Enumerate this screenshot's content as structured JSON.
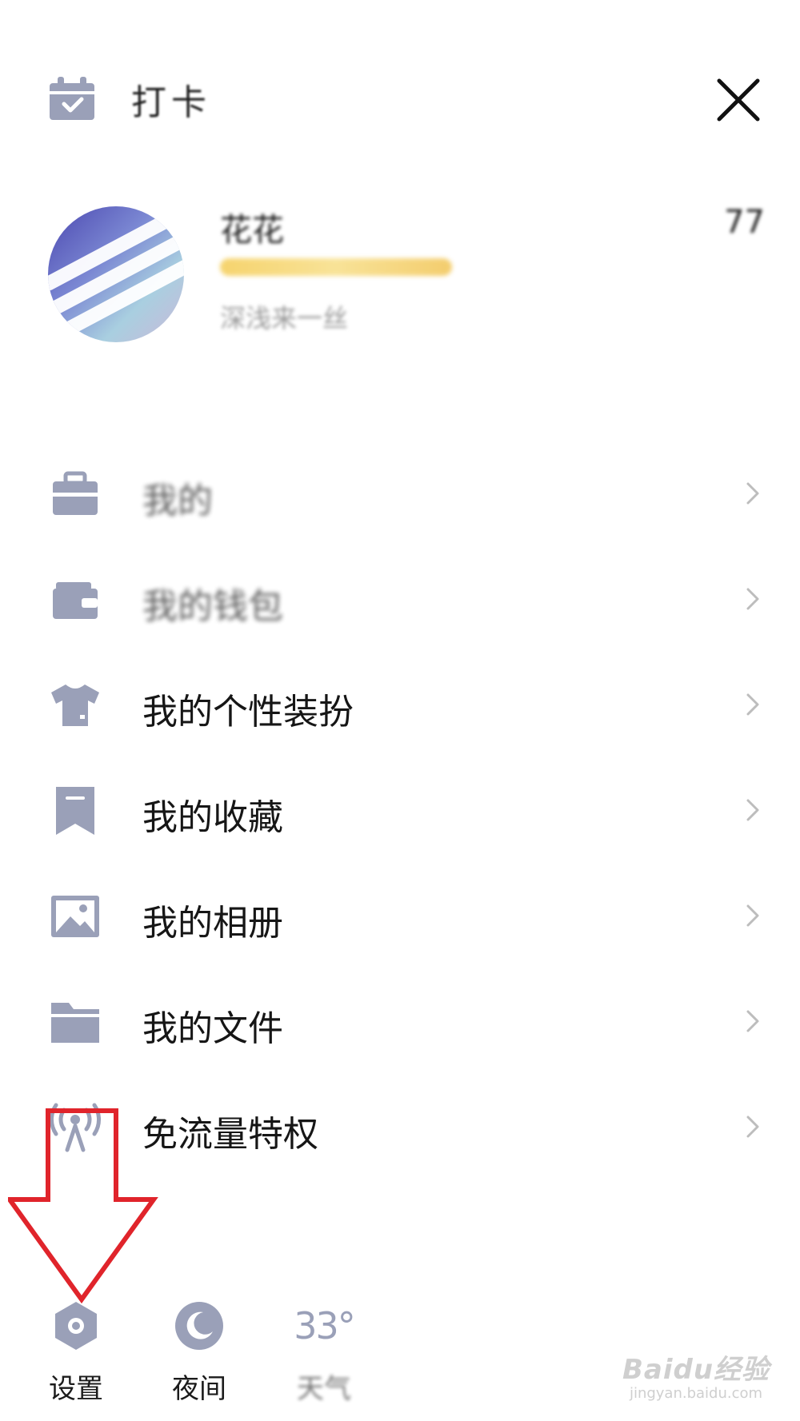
{
  "header": {
    "checkin_label": "打卡",
    "close_icon": "close-icon"
  },
  "profile": {
    "name": "花花",
    "extra": "77",
    "bio": "深浅来一丝"
  },
  "menu": {
    "items": [
      {
        "label": "我的",
        "icon": "bag-icon",
        "blurred": true
      },
      {
        "label": "我的钱包",
        "icon": "wallet-icon",
        "blurred": true
      },
      {
        "label": "我的个性装扮",
        "icon": "shirt-icon",
        "blurred": false
      },
      {
        "label": "我的收藏",
        "icon": "bookmark-icon",
        "blurred": false
      },
      {
        "label": "我的相册",
        "icon": "image-icon",
        "blurred": false
      },
      {
        "label": "我的文件",
        "icon": "folder-icon",
        "blurred": false
      },
      {
        "label": "免流量特权",
        "icon": "signal-icon",
        "blurred": false
      }
    ]
  },
  "bottombar": {
    "settings_label": "设置",
    "night_label": "夜间",
    "temperature": "33°",
    "weather_label": "天气"
  },
  "watermark": {
    "brand": "Baidu经验",
    "url": "jingyan.baidu.com"
  },
  "colors": {
    "icon_gray": "#9aa0b8",
    "annotation_red": "#e0242b",
    "text": "#161616"
  }
}
